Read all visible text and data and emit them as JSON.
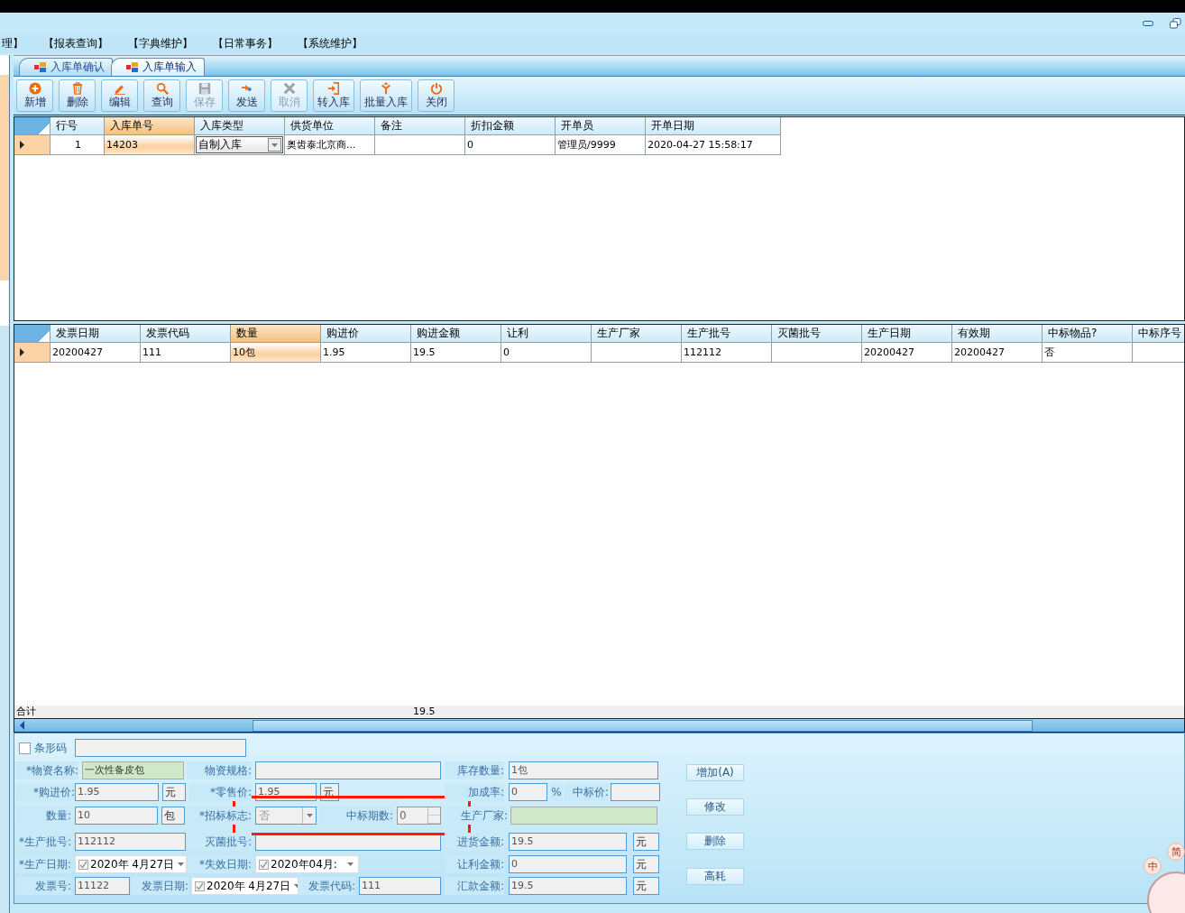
{
  "menu": [
    "理】",
    "【报表查询】",
    "【字典维护】",
    "【日常事务】",
    "【系统维护】"
  ],
  "tabs": [
    {
      "label": "入库单确认",
      "selected": false
    },
    {
      "label": "入库单输入",
      "selected": true
    }
  ],
  "toolbar": [
    {
      "kind": "add",
      "label": "新增",
      "disabled": false
    },
    {
      "kind": "delete",
      "label": "删除",
      "disabled": false
    },
    {
      "kind": "edit",
      "label": "编辑",
      "disabled": false
    },
    {
      "kind": "search",
      "label": "查询",
      "disabled": false
    },
    {
      "kind": "save",
      "label": "保存",
      "disabled": true
    },
    {
      "kind": "send",
      "label": "发送",
      "disabled": false
    },
    {
      "kind": "cancel",
      "label": "取消",
      "disabled": true
    },
    {
      "kind": "import",
      "label": "转入库",
      "disabled": false
    },
    {
      "kind": "batch",
      "label": "批量入库",
      "disabled": false
    },
    {
      "kind": "close",
      "label": "关闭",
      "disabled": false
    }
  ],
  "order_grid": {
    "columns": [
      {
        "label": "行号",
        "value": "1",
        "selected": false
      },
      {
        "label": "入库单号",
        "value": "14203",
        "selected": true
      },
      {
        "label": "入库类型",
        "value": "自制入库",
        "selected": false,
        "kind": "combo"
      },
      {
        "label": "供货单位",
        "value": "奥齿泰北京商...",
        "selected": false
      },
      {
        "label": "备注",
        "selected": false
      },
      {
        "label": "折扣金额",
        "value": "0",
        "selected": false
      },
      {
        "label": "开单员",
        "value": "管理员/9999",
        "selected": false
      },
      {
        "label": "开单日期",
        "value": "2020-04-27 15:58:17",
        "selected": false
      }
    ]
  },
  "item_grid": {
    "columns": [
      {
        "label": "发票日期",
        "value": "20200427",
        "selected": false
      },
      {
        "label": "发票代码",
        "value": "111",
        "selected": false
      },
      {
        "label": "数量",
        "value": "10包",
        "selected": true
      },
      {
        "label": "购进价",
        "value": "1.95",
        "selected": false
      },
      {
        "label": "购进金额",
        "value": "19.5",
        "selected": false,
        "total": "19.5"
      },
      {
        "label": "让利",
        "value": "0",
        "selected": false
      },
      {
        "label": "生产厂家",
        "selected": false
      },
      {
        "label": "生产批号",
        "value": "112112",
        "selected": false
      },
      {
        "label": "灭菌批号",
        "selected": false
      },
      {
        "label": "生产日期",
        "value": "20200427",
        "selected": false
      },
      {
        "label": "有效期",
        "value": "20200427",
        "selected": false
      },
      {
        "label": "中标物品?",
        "value": "否",
        "selected": false
      },
      {
        "label": "中标序号",
        "selected": false
      }
    ],
    "total_label": "合计"
  },
  "form": {
    "fields": [
      {
        "kind": "check_field",
        "label": "条形码",
        "checked": false
      },
      {
        "kind": "field",
        "label": "*物资名称:",
        "value": "一次性备皮包",
        "highlighted": true
      },
      {
        "kind": "field",
        "label": "物资规格:"
      },
      {
        "kind": "field",
        "label": "库存数量:",
        "value": "1包"
      },
      {
        "kind": "field",
        "label": "*购进价:",
        "value": "1.95",
        "unit": "元"
      },
      {
        "kind": "field",
        "label": "*零售价:",
        "value": "1.95",
        "unit": "元"
      },
      {
        "kind": "field",
        "label": "加成率:",
        "value": "0",
        "suffix": "%"
      },
      {
        "kind": "field",
        "label": "中标价:"
      },
      {
        "kind": "field",
        "label": "数量:",
        "value": "10",
        "unit": "包"
      },
      {
        "kind": "combo",
        "label": "*招标标志:",
        "value": "否",
        "disabled": true
      },
      {
        "kind": "spin",
        "label": "中标期数:",
        "value": "0"
      },
      {
        "kind": "field",
        "label": "生产厂家:",
        "highlighted": true
      },
      {
        "kind": "field",
        "label": "*生产批号:",
        "value": "112112"
      },
      {
        "kind": "field",
        "label": "灭菌批号:"
      },
      {
        "kind": "field",
        "label": "进货金额:",
        "value": "19.5",
        "unit": "元"
      },
      {
        "kind": "date",
        "label": "*生产日期:",
        "value": "2020年 4月27日",
        "checked": true
      },
      {
        "kind": "date",
        "label": "*失效日期:",
        "value": "2020年04月:",
        "checked": true
      },
      {
        "kind": "field",
        "label": "让利金额:",
        "value": "0",
        "unit": "元"
      },
      {
        "kind": "field",
        "label": "发票号:",
        "value": "11122"
      },
      {
        "kind": "date",
        "label": "发票日期:",
        "value": "2020年 4月27日",
        "checked": true
      },
      {
        "kind": "field",
        "label": "发票代码:",
        "value": "111"
      },
      {
        "kind": "field",
        "label": "汇款金额:",
        "value": "19.5",
        "unit": "元"
      }
    ],
    "buttons": [
      "增加(A)",
      "修改",
      "删除",
      "高耗"
    ]
  },
  "ime": [
    "中",
    "简"
  ]
}
